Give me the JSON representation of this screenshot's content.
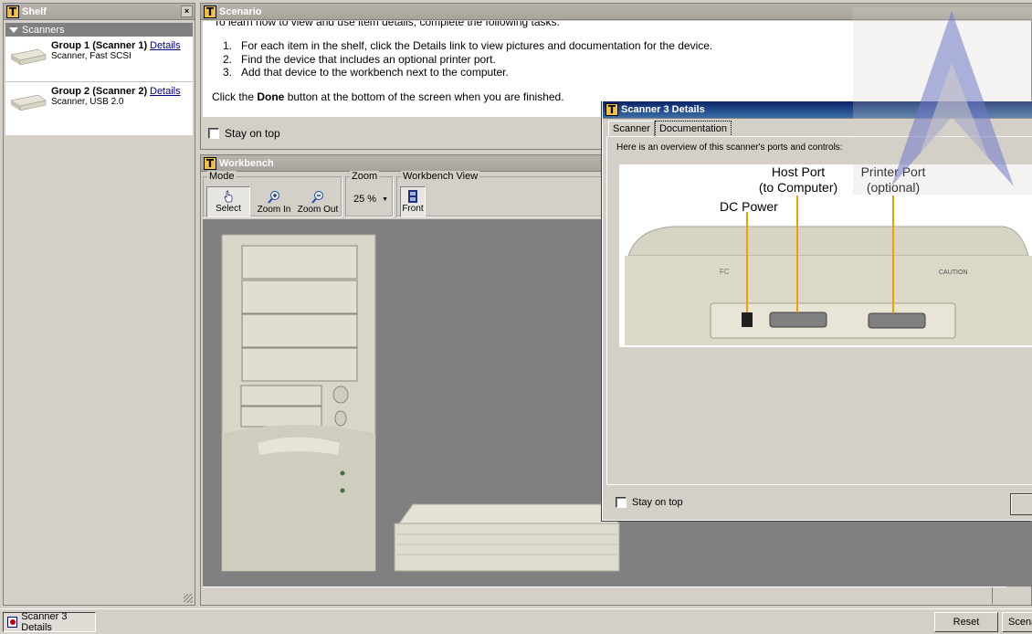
{
  "shelf": {
    "title": "Shelf",
    "close": "×",
    "category": "Scanners",
    "items": [
      {
        "name": "Group 1 (Scanner 1)",
        "details": "Details",
        "desc": "Scanner, Fast SCSI"
      },
      {
        "name": "Group 2 (Scanner 2)",
        "details": "Details",
        "desc": "Scanner, USB 2.0"
      }
    ]
  },
  "scenario": {
    "title": "Scenario",
    "cut_line": "To learn how to view and use item details, complete the following tasks:",
    "steps": [
      {
        "num": "1.",
        "text": "For each item in the shelf, click the Details link to view pictures and documentation for the device."
      },
      {
        "num": "2.",
        "text": "Find the device that includes an optional printer port."
      },
      {
        "num": "3.",
        "text": "Add that device to the workbench next to the computer."
      }
    ],
    "done_prefix": "Click the ",
    "done_word": "Done",
    "done_suffix": " button at the bottom of the screen when you are finished.",
    "stay_on_top": "Stay on top"
  },
  "workbench": {
    "title": "Workbench",
    "mode_label": "Mode",
    "tools": {
      "select": "Select",
      "zoom_in": "Zoom In",
      "zoom_out": "Zoom Out"
    },
    "zoom_label": "Zoom",
    "zoom_value": "25 %",
    "view_label": "Workbench View",
    "view_front": "Front"
  },
  "details_window": {
    "title": "Scanner 3 Details",
    "tabs": [
      "Scanner",
      "Documentation"
    ],
    "selected_tab": "Documentation",
    "overview": "Here is an overview of this scanner's ports and controls:",
    "labels": {
      "dc_power": "DC Power",
      "host_port_1": "Host Port",
      "host_port_2": "(to Computer)",
      "printer_port_1": "Printer Port",
      "printer_port_2": "(optional)"
    },
    "stay_on_top": "Stay on top"
  },
  "taskbar": {
    "task": "Scanner 3 Details",
    "reset": "Reset",
    "scenario": "Scenario"
  },
  "colors": {
    "title_active": "#0a246a",
    "title_inactive": "#a8a49c",
    "workbench_bg": "#808080",
    "port_line": "#f0a000",
    "watermark": "#6f78c8"
  }
}
